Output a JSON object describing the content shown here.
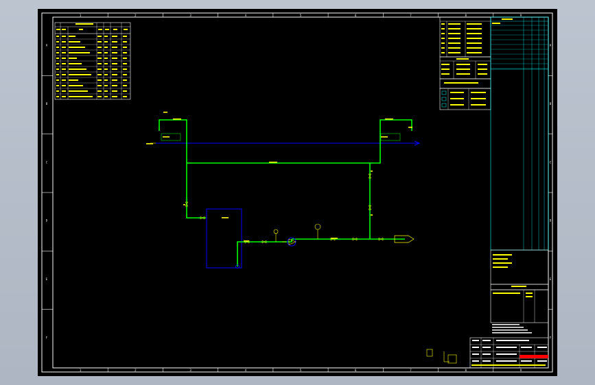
{
  "app": {
    "background_color": "#b8c0cc",
    "canvas_color": "#000000"
  },
  "colors": {
    "border": "#ffffff",
    "table_text": "#ffff00",
    "pipe": "#00ff00",
    "thin_line": "#0000ff",
    "block": "#0000ff",
    "title_grid": "#00ffff",
    "warning": "#ff0000"
  },
  "drawing": {
    "grid_columns": [
      "1",
      "2",
      "3",
      "4",
      "5",
      "6",
      "7",
      "8",
      "9"
    ],
    "grid_rows": [
      "A",
      "B",
      "C",
      "D",
      "E",
      "F"
    ],
    "center_block_label": "",
    "outlet_label": ""
  }
}
